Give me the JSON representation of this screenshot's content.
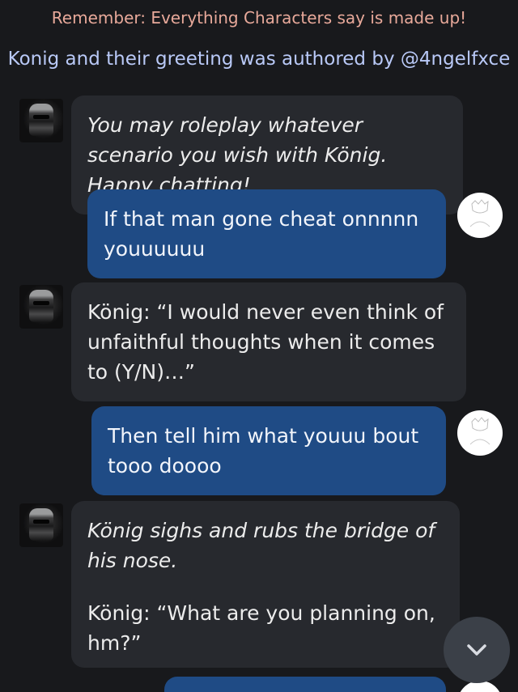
{
  "notices": {
    "remember": "Remember: Everything Characters say is made up!",
    "author": "Konig and their greeting was authored by @4ngelfxce"
  },
  "messages": [
    {
      "sender": "bot",
      "style": "italic",
      "text": "You may roleplay whatever scenario you wish with König. Happy chatting!"
    },
    {
      "sender": "user",
      "text": "If that man gone cheat onnnnn youuuuuu"
    },
    {
      "sender": "bot",
      "text": "König: “I would never even think of unfaithful thoughts when it comes to (Y/N)…”"
    },
    {
      "sender": "user",
      "text": "Then tell him what youuu bout tooo doooo"
    },
    {
      "sender": "bot",
      "action": "König sighs and rubs the bridge of his nose.",
      "text": "König: “What are you planning on, hm?”"
    }
  ],
  "controls": {
    "scroll_down_icon": "chevron-down-icon"
  },
  "colors": {
    "background": "#18191c",
    "bot_bubble": "#27292e",
    "user_bubble": "#1f4b85",
    "remember_text": "#e8a99a",
    "author_text": "#b9c9f7"
  }
}
